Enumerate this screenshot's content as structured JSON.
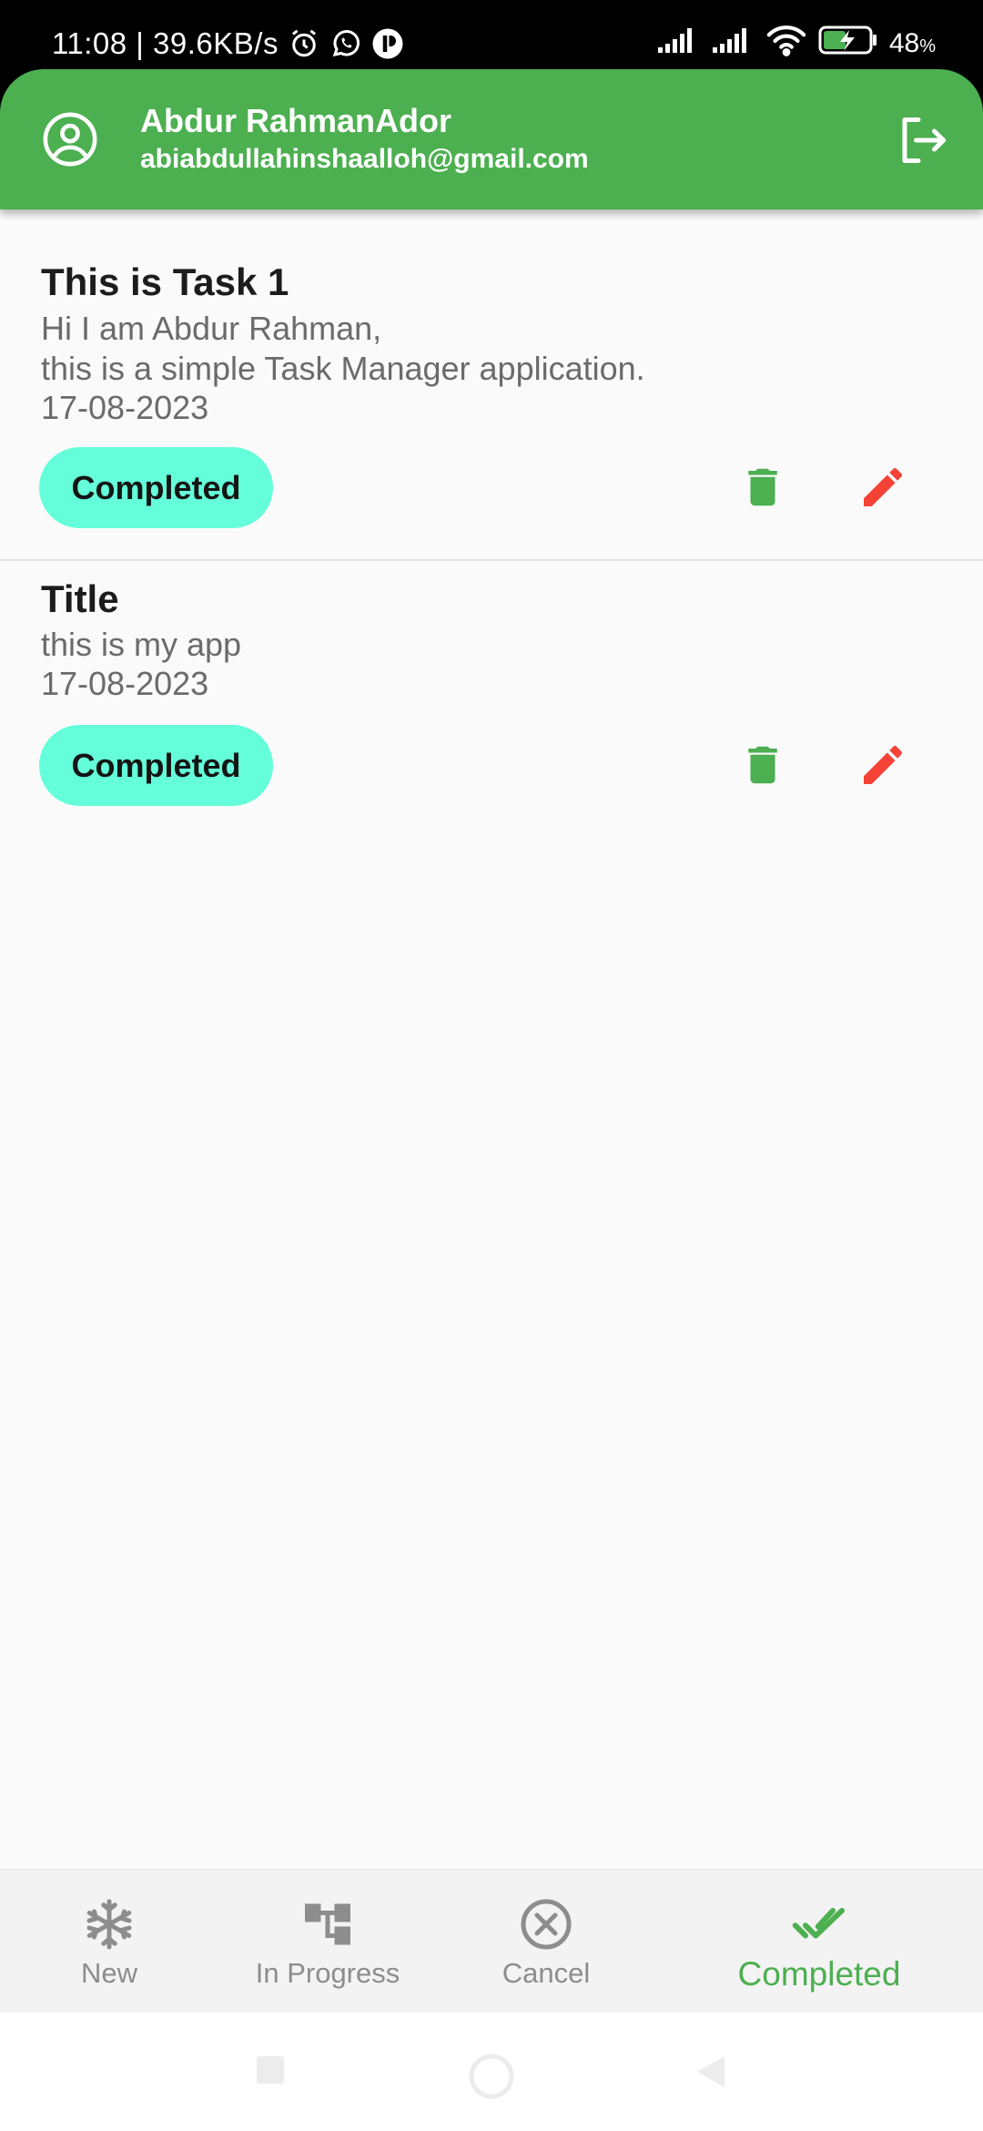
{
  "status_bar": {
    "time_speed": "11:08 | 39.6KB/s",
    "battery": "48",
    "battery_unit": "%",
    "icons": [
      "alarm-icon",
      "whatsapp-icon",
      "app-notification-icon",
      "signal-icon",
      "signal-icon",
      "wifi-icon",
      "battery-charging-icon"
    ]
  },
  "header": {
    "name": "Abdur RahmanAdor",
    "email": "abiabdullahinshaalloh@gmail.com",
    "avatar_icon": "account-circle-icon",
    "logout_icon": "logout-icon",
    "color": "#4caf50"
  },
  "tasks": [
    {
      "title": "This is Task 1",
      "description": "Hi I am Abdur Rahman,\nthis is a simple Task Manager application.",
      "date": "17-08-2023",
      "status": "Completed"
    },
    {
      "title": "Title",
      "description": "this is my app",
      "date": "17-08-2023",
      "status": "Completed"
    }
  ],
  "colors": {
    "chip": "#64ffda",
    "delete": "#4caf50",
    "edit": "#f44336",
    "nav_active": "#4caf50",
    "nav_inactive": "#8d8d8d"
  },
  "bottom_nav": {
    "items": [
      {
        "label": "New",
        "icon": "snowflake-icon",
        "active": false
      },
      {
        "label": "In Progress",
        "icon": "account-tree-icon",
        "active": false
      },
      {
        "label": "Cancel",
        "icon": "cancel-icon",
        "active": false
      },
      {
        "label": "Completed",
        "icon": "done-all-icon",
        "active": true
      }
    ]
  },
  "system_nav": {
    "icons": [
      "recent-apps-icon",
      "home-icon",
      "back-icon"
    ]
  }
}
